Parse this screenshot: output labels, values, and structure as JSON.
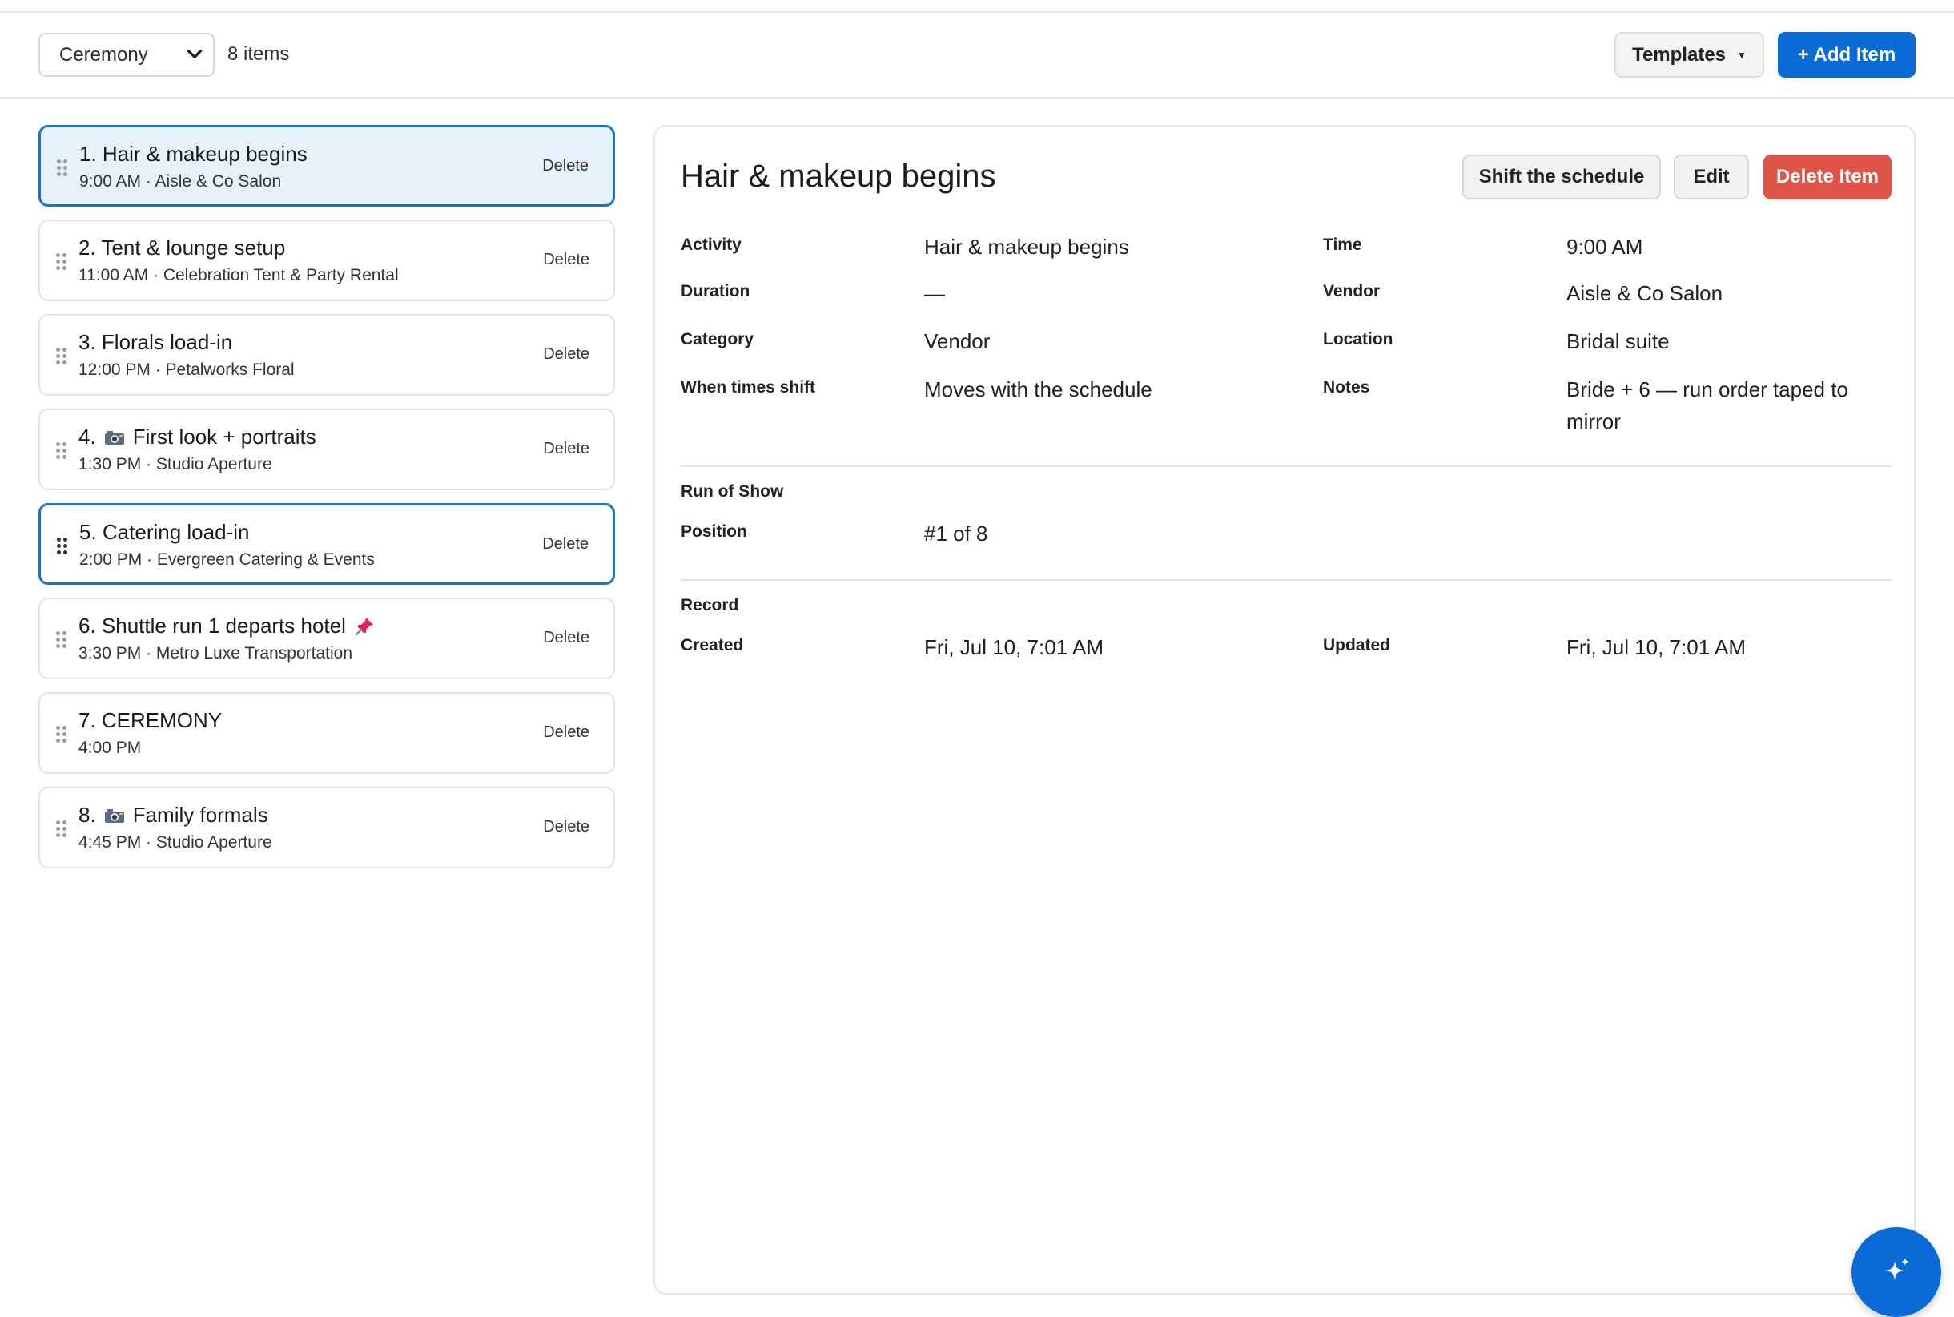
{
  "toolbar": {
    "view_selected": "Ceremony",
    "item_count": "8 items",
    "templates_label": "Templates",
    "add_item_label": "+ Add Item"
  },
  "items": [
    {
      "title": "1. Hair & makeup begins",
      "subtitle": "9:00 AM · Aisle & Co Salon",
      "delete": "Delete",
      "icon": ""
    },
    {
      "title": "2. Tent & lounge setup",
      "subtitle": "11:00 AM · Celebration Tent & Party Rental",
      "delete": "Delete",
      "icon": ""
    },
    {
      "title": "3. Florals load-in",
      "subtitle": "12:00 PM · Petalworks Floral",
      "delete": "Delete",
      "icon": ""
    },
    {
      "title_prefix": "4.",
      "title": "First look + portraits",
      "subtitle": "1:30 PM · Studio Aperture",
      "delete": "Delete",
      "icon": "camera-icon"
    },
    {
      "title": "5. Catering load-in",
      "subtitle": "2:00 PM · Evergreen Catering & Events",
      "delete": "Delete",
      "icon": ""
    },
    {
      "title": "6. Shuttle run 1 departs hotel",
      "subtitle": "3:30 PM · Metro Luxe Transportation",
      "delete": "Delete",
      "icon": "pushpin-icon"
    },
    {
      "title": "7. CEREMONY",
      "subtitle": "4:00 PM",
      "delete": "Delete",
      "icon": ""
    },
    {
      "title_prefix": "8.",
      "title": "Family formals",
      "subtitle": "4:45 PM · Studio Aperture",
      "delete": "Delete",
      "icon": "camera-icon"
    }
  ],
  "detail": {
    "title": "Hair & makeup begins",
    "shift_label": "Shift the schedule",
    "edit_label": "Edit",
    "delete_label": "Delete Item",
    "fields": {
      "activity_label": "Activity",
      "activity": "Hair & makeup begins",
      "time_label": "Time",
      "time": "9:00 AM",
      "duration_label": "Duration",
      "duration": "—",
      "vendor_label": "Vendor",
      "vendor": "Aisle & Co Salon",
      "category_label": "Category",
      "category": "Vendor",
      "location_label": "Location",
      "location": "Bridal suite",
      "shift_label": "When times shift",
      "shift": "Moves with the schedule",
      "notes_label": "Notes",
      "notes": "Bride + 6 — run order taped to mirror"
    },
    "run_of_show": {
      "heading": "Run of Show",
      "position_label": "Position",
      "position": "#1 of 8"
    },
    "record": {
      "heading": "Record",
      "created_label": "Created",
      "created": "Fri, Jul 10, 7:01 AM",
      "updated_label": "Updated",
      "updated": "Fri, Jul 10, 7:01 AM"
    }
  },
  "colors": {
    "primary": "#0a6ad6",
    "danger": "#de5446",
    "active_bg": "#e6f1fb",
    "active_border": "#1a73c9"
  },
  "fab_icon": "sparkle-icon"
}
